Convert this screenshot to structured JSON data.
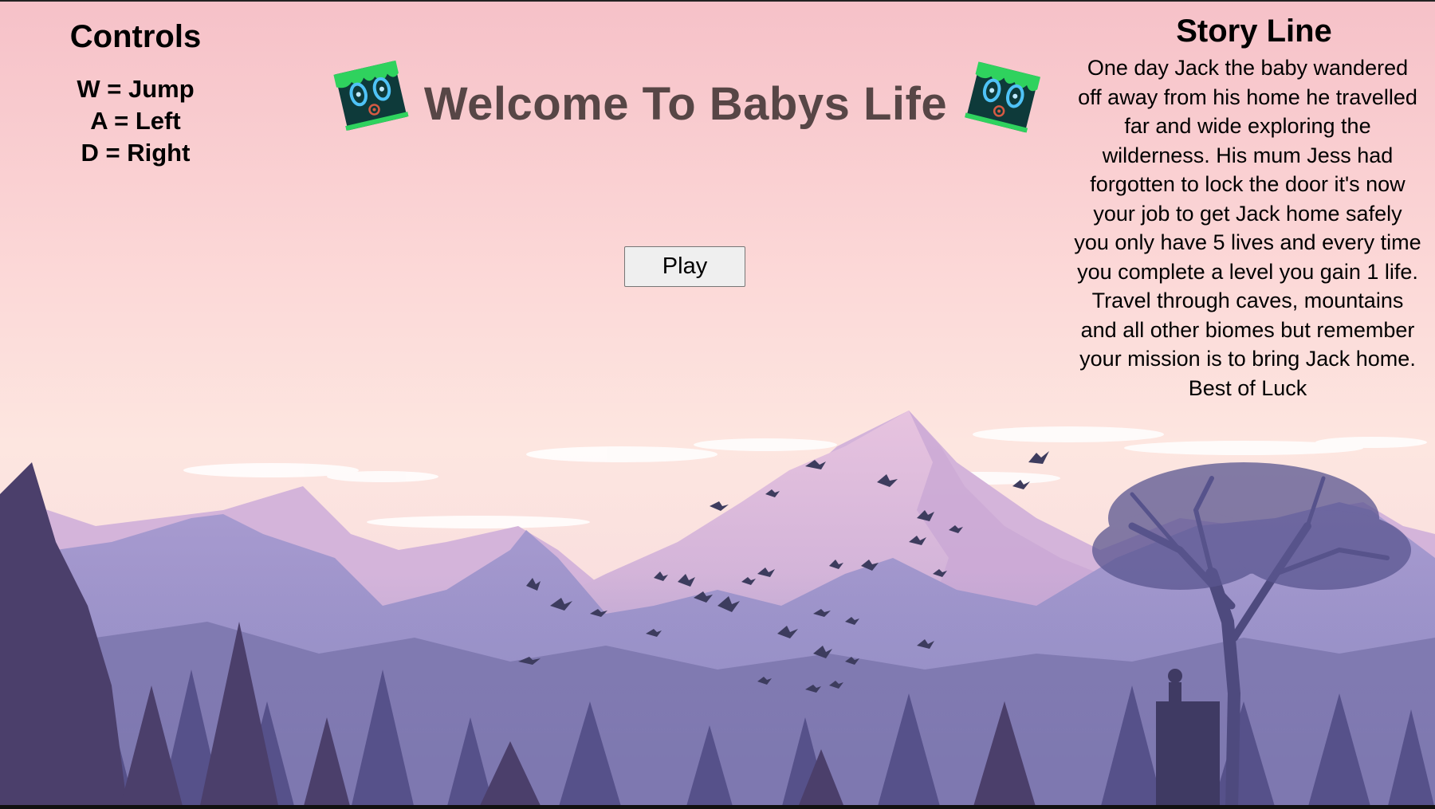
{
  "title": "Welcome To Babys Life",
  "controls": {
    "heading": "Controls",
    "lines": [
      "W = Jump",
      "A = Left",
      "D = Right"
    ]
  },
  "play_button": {
    "label": "Play"
  },
  "story": {
    "heading": "Story Line",
    "text": "One day Jack the baby wandered off away from his home he travelled far and wide exploring the wilderness. His mum Jess had forgotten to lock the door it's now your job to get Jack home safely you only have 5 lives and every time you complete a level you gain 1 life. Travel through caves, mountains and all other biomes but remember your mission is to bring Jack home. Best of Luck"
  },
  "icons": {
    "mascot": "green-slime-creature-icon",
    "backdrop": "mountain-landscape-with-birds"
  },
  "colors": {
    "sky_top": "#f7c3cb",
    "sky_mid": "#fde3e1",
    "mountain_far": "#c9a8d8",
    "mountain_near": "#8a7fb8",
    "forest": "#4a4a78",
    "title_text": "#574646",
    "mascot_green": "#2fd25e",
    "mascot_dark": "#0e3a3a"
  }
}
